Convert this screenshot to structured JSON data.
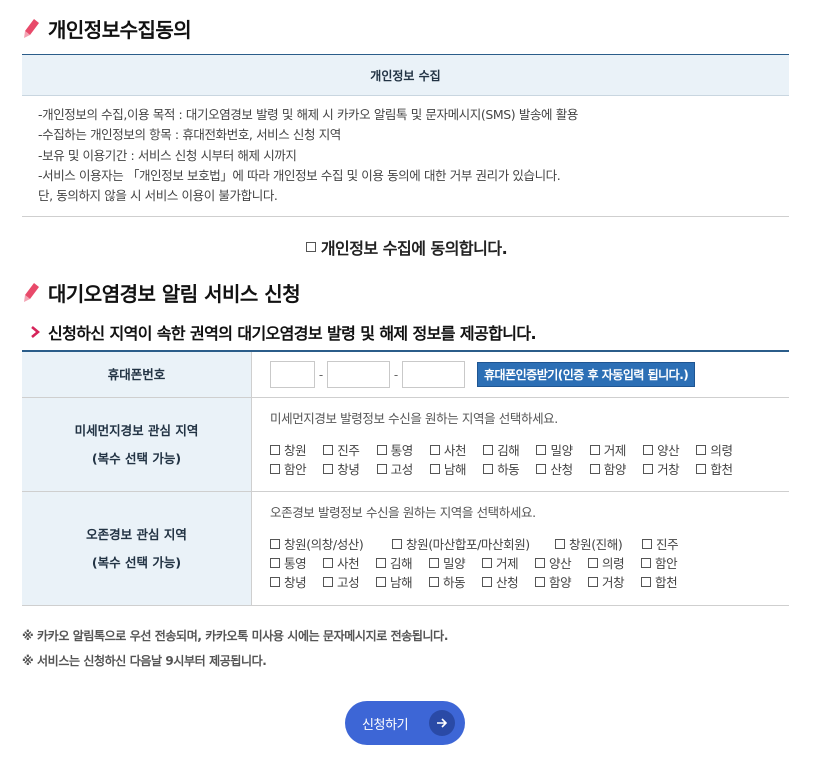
{
  "sections": {
    "privacy_title": "개인정보수집동의",
    "service_title": "대기오염경보 알림 서비스 신청"
  },
  "consent": {
    "header": "개인정보 수집",
    "lines": [
      "-개인정보의 수집,이용 목적 : 대기오염경보 발령 및 해제 시 카카오 알림톡 및 문자메시지(SMS) 발송에 활용",
      "-수집하는 개인정보의 항목 : 휴대전화번호, 서비스 신청 지역",
      "-보유 및 이용기간 : 서비스 신청 시부터 해제 시까지",
      "-서비스 이용자는 「개인정보 보호법」에 따라 개인정보 수집 및 이용 동의에 대한 거부 권리가 있습니다.",
      "단, 동의하지 않을 시 서비스 이용이 불가합니다."
    ],
    "agree_label": "개인정보 수집에 동의합니다.",
    "agree_checked": false
  },
  "subtitle": "신청하신 지역이 속한 권역의 대기오염경보 발령 및 해제 정보를 제공합니다.",
  "form": {
    "phone": {
      "label": "휴대폰번호",
      "part1": "",
      "part2": "",
      "part3": "",
      "separator": "-",
      "verify_button": "휴대폰인증받기(인증 후 자동입력 됩니다.)"
    },
    "pm_region": {
      "label": "미세먼지경보 관심 지역",
      "sub_label": "(복수 선택 가능)",
      "hint": "미세먼지경보 발령정보 수신을 원하는 지역을 선택하세요.",
      "rows": [
        [
          "창원",
          "진주",
          "통영",
          "사천",
          "김해",
          "밀양",
          "거제",
          "양산",
          "의령"
        ],
        [
          "함안",
          "창녕",
          "고성",
          "남해",
          "하동",
          "산청",
          "함양",
          "거창",
          "합천"
        ]
      ]
    },
    "ozone_region": {
      "label": "오존경보 관심 지역",
      "sub_label": "(복수 선택 가능)",
      "hint": "오존경보 발령정보 수신을 원하는 지역을 선택하세요.",
      "rows": [
        [
          "창원(의창/성산)",
          "창원(마산합포/마산회원)",
          "창원(진해)",
          "진주"
        ],
        [
          "통영",
          "사천",
          "김해",
          "밀양",
          "거제",
          "양산",
          "의령",
          "함안"
        ],
        [
          "창녕",
          "고성",
          "남해",
          "하동",
          "산청",
          "함양",
          "거창",
          "합천"
        ]
      ]
    }
  },
  "notes": [
    "※ 카카오 알림톡으로 우선 전송되며, 카카오톡 미사용 시에는 문자메시지로 전송됩니다.",
    "※ 서비스는 신청하신 다음날 9시부터 제공됩니다."
  ],
  "submit_label": "신청하기",
  "colors": {
    "primary": "#2b5d8a",
    "header_bg": "#eaf2f8",
    "button_blue": "#3d66d6",
    "verify_blue": "#2c6fb5",
    "accent_pen": "#e84a6a",
    "chevron": "#d6245a"
  }
}
